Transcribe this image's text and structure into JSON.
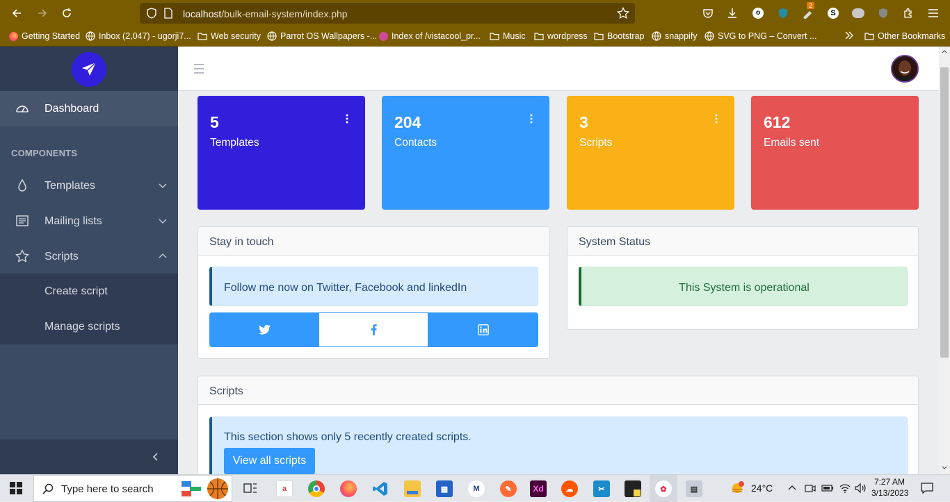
{
  "browser": {
    "url_host": "localhost",
    "url_path": "/bulk-email-system/index.php",
    "download_badge": "2",
    "bookmarks": [
      {
        "label": "Getting Started",
        "icon": "firefox-icon"
      },
      {
        "label": "Inbox (2,047) - ugorji7...",
        "icon": "globe-icon"
      },
      {
        "label": "Web security",
        "icon": "folder-icon"
      },
      {
        "label": "Parrot OS Wallpapers -...",
        "icon": "globe-icon"
      },
      {
        "label": "Index of /vistacool_pr...",
        "icon": "site-icon"
      },
      {
        "label": "Music",
        "icon": "folder-icon"
      },
      {
        "label": "wordpress",
        "icon": "folder-icon"
      },
      {
        "label": "Bootstrap",
        "icon": "folder-icon"
      },
      {
        "label": "snappify",
        "icon": "globe-icon"
      },
      {
        "label": "SVG to PNG – Convert ...",
        "icon": "globe-icon"
      }
    ],
    "other_bookmarks": "Other Bookmarks"
  },
  "sidebar": {
    "dashboard": "Dashboard",
    "section_title": "COMPONENTS",
    "templates": "Templates",
    "mailing_lists": "Mailing lists",
    "scripts": "Scripts",
    "create_script": "Create script",
    "manage_scripts": "Manage scripts"
  },
  "widgets": [
    {
      "value": "5",
      "label": "Templates",
      "color": "#321fdb"
    },
    {
      "value": "204",
      "label": "Contacts",
      "color": "#39f"
    },
    {
      "value": "3",
      "label": "Scripts",
      "color": "#f9b115"
    },
    {
      "value": "612",
      "label": "Emails sent",
      "color": "#e55353"
    }
  ],
  "stay_in_touch": {
    "title": "Stay in touch",
    "message": "Follow me now on Twitter, Facebook and linkedIn"
  },
  "system_status": {
    "title": "System Status",
    "message": "This System is operational"
  },
  "scripts_card": {
    "title": "Scripts",
    "message": "This section shows only 5 recently created scripts.",
    "button": "View all scripts"
  },
  "taskbar": {
    "search_placeholder": "Type here to search",
    "weather": "24°C",
    "time": "7:27 AM",
    "date": "3/13/2023"
  }
}
